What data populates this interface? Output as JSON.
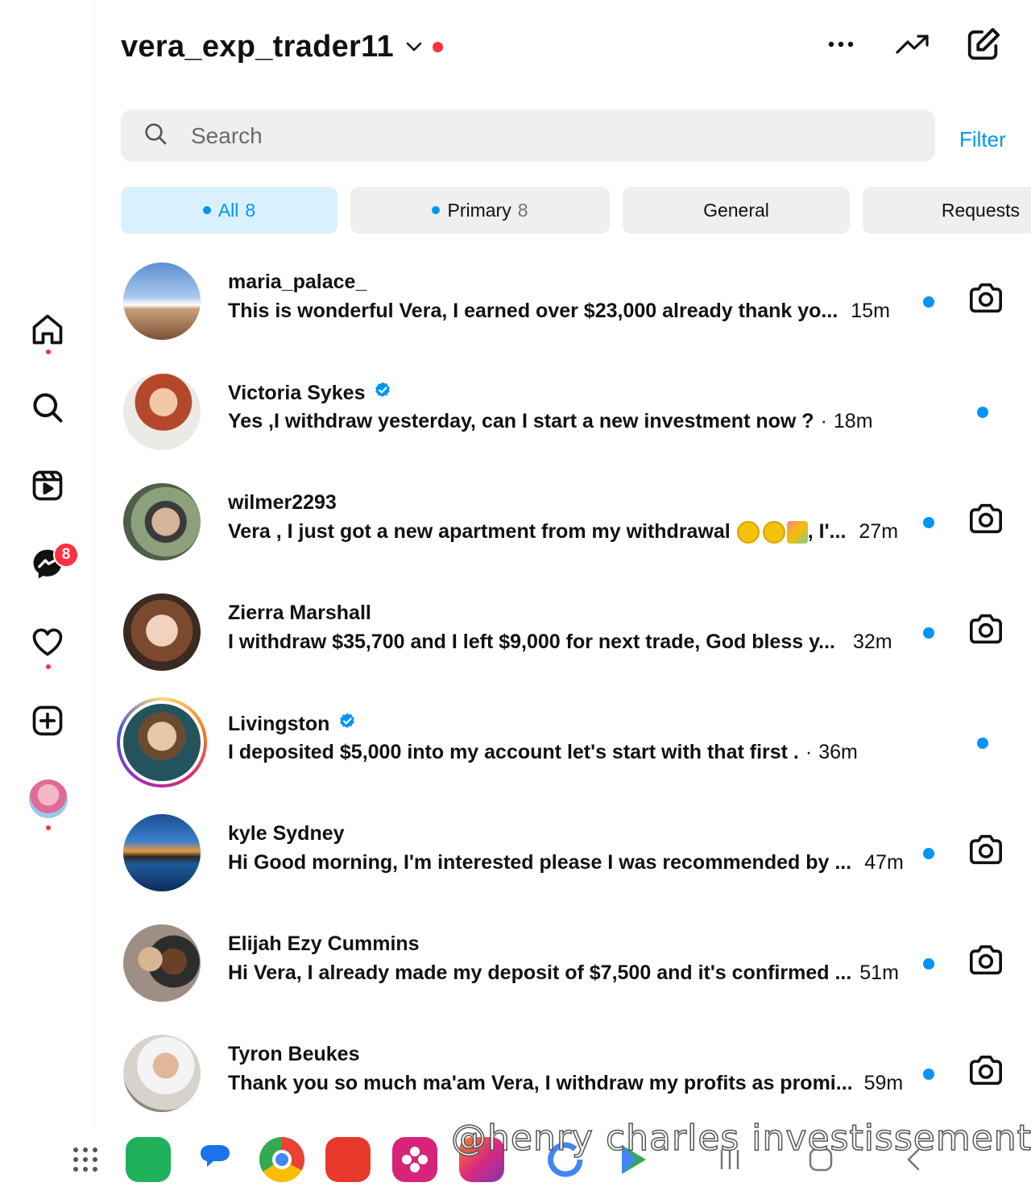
{
  "header": {
    "username": "vera_exp_trader11"
  },
  "search": {
    "placeholder": "Search",
    "filter_label": "Filter"
  },
  "tabs": [
    {
      "label": "All",
      "count": "8"
    },
    {
      "label": "Primary",
      "count": "8"
    },
    {
      "label": "General"
    },
    {
      "label": "Requests"
    }
  ],
  "rail": {
    "messages_badge": "8"
  },
  "conversations": [
    {
      "name": "maria_palace_",
      "message": "This is wonderful Vera,  I earned over $23,000 already thank yo...",
      "time": "15m",
      "verified": false,
      "camera": true
    },
    {
      "name": "Victoria Sykes",
      "message": "Yes ,I withdraw yesterday,  can I start a new investment now ?",
      "time": "18m",
      "verified": true,
      "camera": false
    },
    {
      "name": "wilmer2293",
      "message": "Vera , I just got a new apartment from my withdrawal",
      "message_tail": ", I'...",
      "time": "27m",
      "verified": false,
      "camera": true
    },
    {
      "name": "Zierra Marshall",
      "message": "I withdraw $35,700 and I left $9,000 for next trade, God bless y...",
      "time": "32m",
      "verified": false,
      "camera": true
    },
    {
      "name": "Livingston",
      "message": "I deposited $5,000 into my account let's start with that first .",
      "time": "36m",
      "verified": true,
      "camera": false
    },
    {
      "name": "kyle Sydney",
      "message": "Hi Good morning, I'm interested please I was recommended by ...",
      "time": "47m",
      "verified": false,
      "camera": true
    },
    {
      "name": "Elijah Ezy Cummins",
      "message": "Hi Vera, I already made my deposit of $7,500 and it's confirmed ...",
      "time": "51m",
      "verified": false,
      "camera": true
    },
    {
      "name": "Tyron Beukes",
      "message": "Thank you so much ma'am Vera, I withdraw my profits as promi...",
      "time": "59m",
      "verified": false,
      "camera": true
    }
  ],
  "watermark": "@henry charles investissement",
  "colors": {
    "accent": "#0095f6",
    "notification": "#ff3040",
    "tab_active_bg": "#dbf0fd"
  }
}
